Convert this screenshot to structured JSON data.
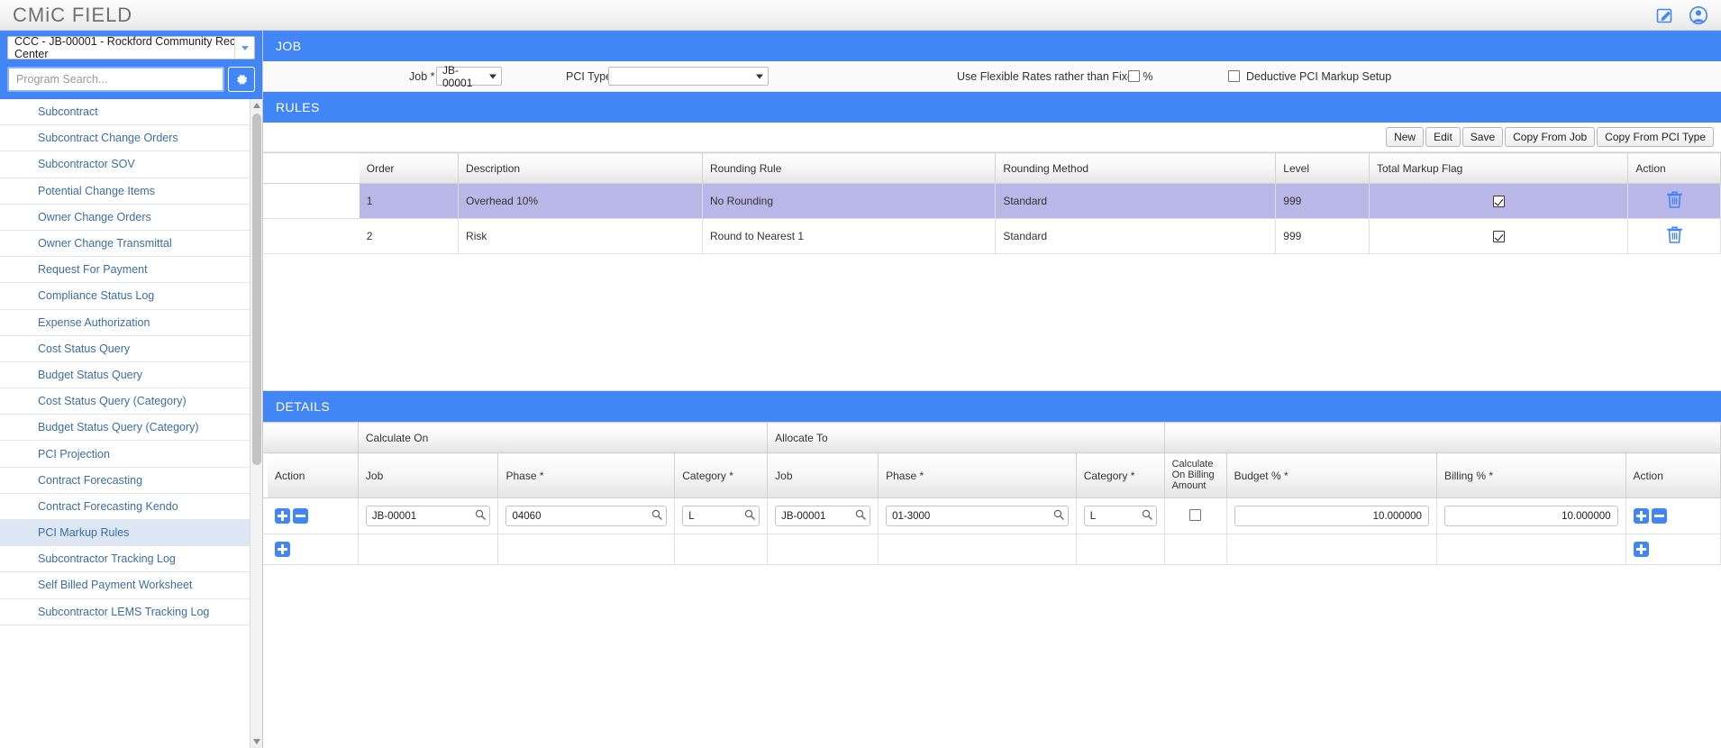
{
  "app": {
    "brand_1": "CMiC",
    "brand_2": "FIELD",
    "edit_icon": "edit-pencil-icon",
    "user_icon": "user-avatar-icon"
  },
  "sidebar": {
    "project_select_value": "CCC - JB-00001 - Rockford Community Rec Center",
    "search_placeholder": "Program Search...",
    "gear_icon": "gear-icon",
    "items": [
      {
        "label": "Subcontract",
        "active": false
      },
      {
        "label": "Subcontract Change Orders",
        "active": false
      },
      {
        "label": "Subcontractor SOV",
        "active": false
      },
      {
        "label": "Potential Change Items",
        "active": false
      },
      {
        "label": "Owner Change Orders",
        "active": false
      },
      {
        "label": "Owner Change Transmittal",
        "active": false
      },
      {
        "label": "Request For Payment",
        "active": false
      },
      {
        "label": "Compliance Status Log",
        "active": false
      },
      {
        "label": "Expense Authorization",
        "active": false
      },
      {
        "label": "Cost Status Query",
        "active": false
      },
      {
        "label": "Budget Status Query",
        "active": false
      },
      {
        "label": "Cost Status Query (Category)",
        "active": false
      },
      {
        "label": "Budget Status Query (Category)",
        "active": false
      },
      {
        "label": "PCI Projection",
        "active": false
      },
      {
        "label": "Contract Forecasting",
        "active": false
      },
      {
        "label": "Contract Forecasting Kendo",
        "active": false
      },
      {
        "label": "PCI Markup Rules",
        "active": true
      },
      {
        "label": "Subcontractor Tracking Log",
        "active": false
      },
      {
        "label": "Self Billed Payment Worksheet",
        "active": false
      },
      {
        "label": "Subcontractor LEMS Tracking Log",
        "active": false
      }
    ]
  },
  "job_panel": {
    "title": "JOB",
    "job_label": "Job *",
    "job_value": "JB-00001",
    "pci_type_label": "PCI Type",
    "pci_type_value": "",
    "flexible_rates_label": "Use Flexible Rates rather than Fixed %",
    "flexible_rates_checked": false,
    "deductive_label": "Deductive PCI Markup Setup",
    "deductive_checked": false
  },
  "rules_panel": {
    "title": "RULES",
    "buttons": [
      "New",
      "Edit",
      "Save",
      "Copy From Job",
      "Copy From PCI Type"
    ],
    "columns": [
      "Order",
      "Description",
      "Rounding Rule",
      "Rounding Method",
      "Level",
      "Total Markup Flag",
      "Action"
    ],
    "rows": [
      {
        "order": "1",
        "description": "Overhead 10%",
        "rounding_rule": "No Rounding",
        "rounding_method": "Standard",
        "level": "999",
        "total_markup_flag": true,
        "action_icon": "trash-icon",
        "selected": true
      },
      {
        "order": "2",
        "description": "Risk",
        "rounding_rule": "Round to Nearest 1",
        "rounding_method": "Standard",
        "level": "999",
        "total_markup_flag": true,
        "action_icon": "trash-icon",
        "selected": false
      }
    ]
  },
  "details_panel": {
    "title": "DETAILS",
    "group_headers": {
      "calculate_on": "Calculate On",
      "allocate_to": "Allocate To"
    },
    "columns": [
      "Action",
      "Job",
      "Phase *",
      "Category *",
      "Job",
      "Phase *",
      "Category *",
      "Calculate On Billing Amount",
      "Budget % *",
      "Billing % *",
      "Action"
    ],
    "rows": [
      {
        "calc_job": "JB-00001",
        "calc_phase": "04060",
        "calc_category": "L",
        "alloc_job": "JB-00001",
        "alloc_phase": "01-3000",
        "alloc_category": "L",
        "calc_on_billing_amount": false,
        "budget_pct": "10.000000",
        "billing_pct": "10.000000",
        "add_icon": "plus-icon",
        "remove_icon": "minus-icon"
      }
    ],
    "add_row_icon": "plus-icon",
    "search_icon": "magnifier-icon"
  },
  "colors": {
    "accent": "#4285f4",
    "selected_row": "#b9b6e8",
    "sidebar_active": "#dce7f3",
    "link": "#3a6ea5"
  }
}
